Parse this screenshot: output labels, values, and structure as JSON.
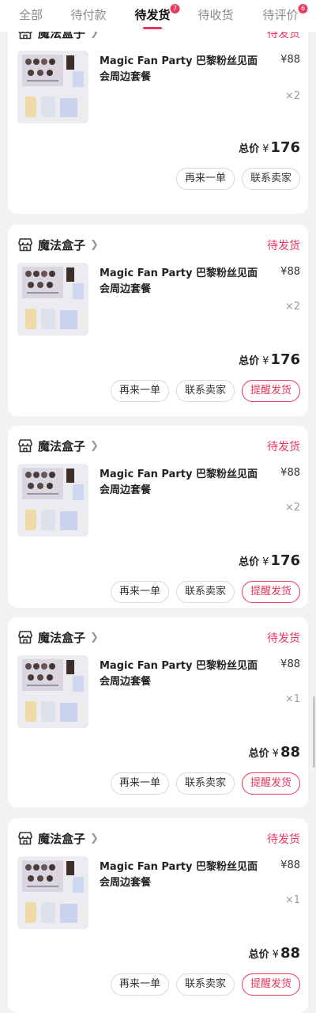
{
  "tabs": {
    "all": "全部",
    "pending_payment": "待付款",
    "pending_shipment": "待发货",
    "pending_shipment_badge": "7",
    "pending_receipt": "待收货",
    "pending_review": "待评价",
    "pending_review_badge": "6"
  },
  "orders": [
    {
      "shop": "魔法盒子",
      "status": "待发货",
      "title": "Magic Fan Party 巴黎粉丝见面会周边套餐",
      "price": "¥88",
      "qty": "×2",
      "total_label": "总价",
      "total_currency": "¥",
      "total": "176",
      "btn_reorder": "再来一单",
      "btn_contact": "联系卖家"
    },
    {
      "shop": "魔法盒子",
      "status": "待发货",
      "title": "Magic Fan Party 巴黎粉丝见面会周边套餐",
      "price": "¥88",
      "qty": "×2",
      "total_label": "总价",
      "total_currency": "¥",
      "total": "176",
      "btn_reorder": "再来一单",
      "btn_contact": "联系卖家",
      "btn_remind": "提醒发货"
    },
    {
      "shop": "魔法盒子",
      "status": "待发货",
      "title": "Magic Fan Party 巴黎粉丝见面会周边套餐",
      "price": "¥88",
      "qty": "×2",
      "total_label": "总价",
      "total_currency": "¥",
      "total": "176",
      "btn_reorder": "再来一单",
      "btn_contact": "联系卖家",
      "btn_remind": "提醒发货"
    },
    {
      "shop": "魔法盒子",
      "status": "待发货",
      "title": "Magic Fan Party 巴黎粉丝见面会周边套餐",
      "price": "¥88",
      "qty": "×1",
      "total_label": "总价",
      "total_currency": "¥",
      "total": "88",
      "btn_reorder": "再来一单",
      "btn_contact": "联系卖家",
      "btn_remind": "提醒发货"
    },
    {
      "shop": "魔法盒子",
      "status": "待发货",
      "title": "Magic Fan Party 巴黎粉丝见面会周边套餐",
      "price": "¥88",
      "qty": "×1",
      "total_label": "总价",
      "total_currency": "¥",
      "total": "88",
      "btn_reorder": "再来一单",
      "btn_contact": "联系卖家",
      "btn_remind": "提醒发货"
    }
  ],
  "colors": {
    "accent": "#e8365d",
    "badge": "#ea3c5f",
    "background": "#f2f2f4"
  },
  "icons": {
    "shop": "shop-icon",
    "chevron": "chevron-right-icon"
  }
}
